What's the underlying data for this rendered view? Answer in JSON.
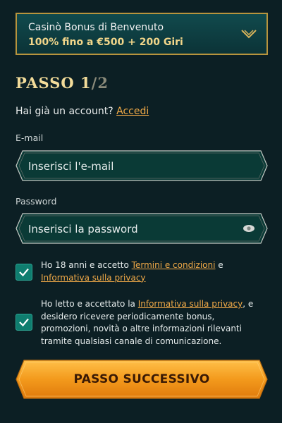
{
  "bonus": {
    "title": "Casinò Bonus di Benvenuto",
    "offer": "100% fino a €500 + 200 Giri"
  },
  "step": {
    "current": "PASSO 1",
    "total": "/2"
  },
  "account": {
    "prompt": "Hai già un account?",
    "login_link": "Accedi"
  },
  "email": {
    "label": "E-mail",
    "placeholder": "Inserisci l'e-mail"
  },
  "password": {
    "label": "Password",
    "placeholder": "Inserisci la password"
  },
  "consent_terms": {
    "text_before": "Ho 18 anni e accetto ",
    "terms_link": "Termini e condizioni",
    "text_middle": " e ",
    "privacy_link": "Informativa sulla privacy"
  },
  "consent_marketing": {
    "text_before": "Ho letto e accettato la ",
    "privacy_link": "Informativa sulla privacy",
    "text_after": ", e desidero ricevere periodicamente bonus, promozioni, novità o altre informazioni rilevanti tramite qualsiasi canale di comunicazione."
  },
  "next_button": {
    "label": "PASSO SUCCESSIVO"
  },
  "icons": {
    "bonus_toggle": "chevron-down-icon",
    "password_visibility": "eye-icon",
    "checkbox_mark": "checkmark-icon"
  },
  "colors": {
    "background": "#0c1f24",
    "accent_gold": "#b8943d",
    "link_orange": "#f0a947",
    "checkbox_teal": "#0f7d6f",
    "button_orange": "#f39a1c"
  }
}
